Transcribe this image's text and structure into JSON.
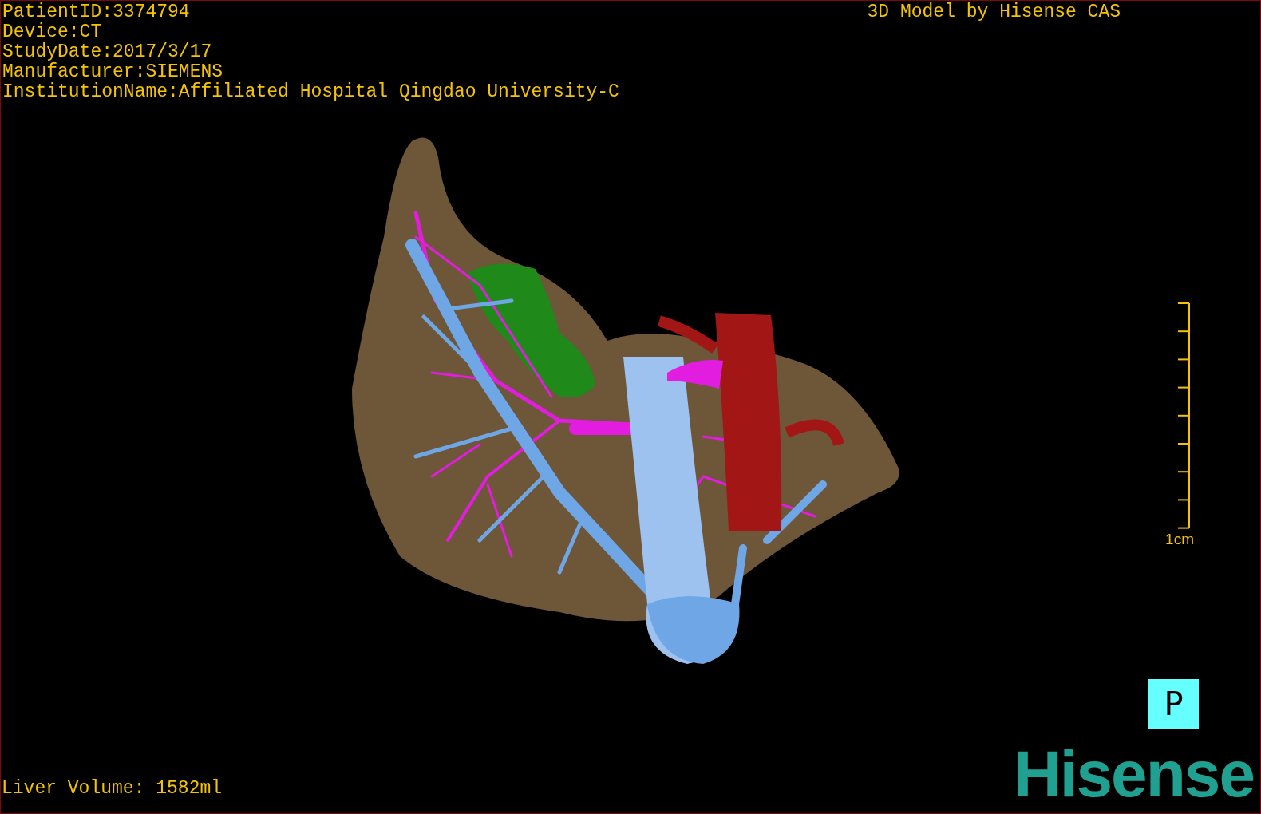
{
  "info_lines": [
    "PatientID:3374794",
    "Device:CT",
    "StudyDate:2017/3/17",
    "Manufacturer:SIEMENS",
    "InstitutionName:Affiliated Hospital Qingdao University-C"
  ],
  "title": "3D Model by Hisense CAS",
  "scale": {
    "label": "1cm"
  },
  "orientation": "P",
  "volume": "Liver Volume: 1582ml",
  "logo": "Hisense"
}
